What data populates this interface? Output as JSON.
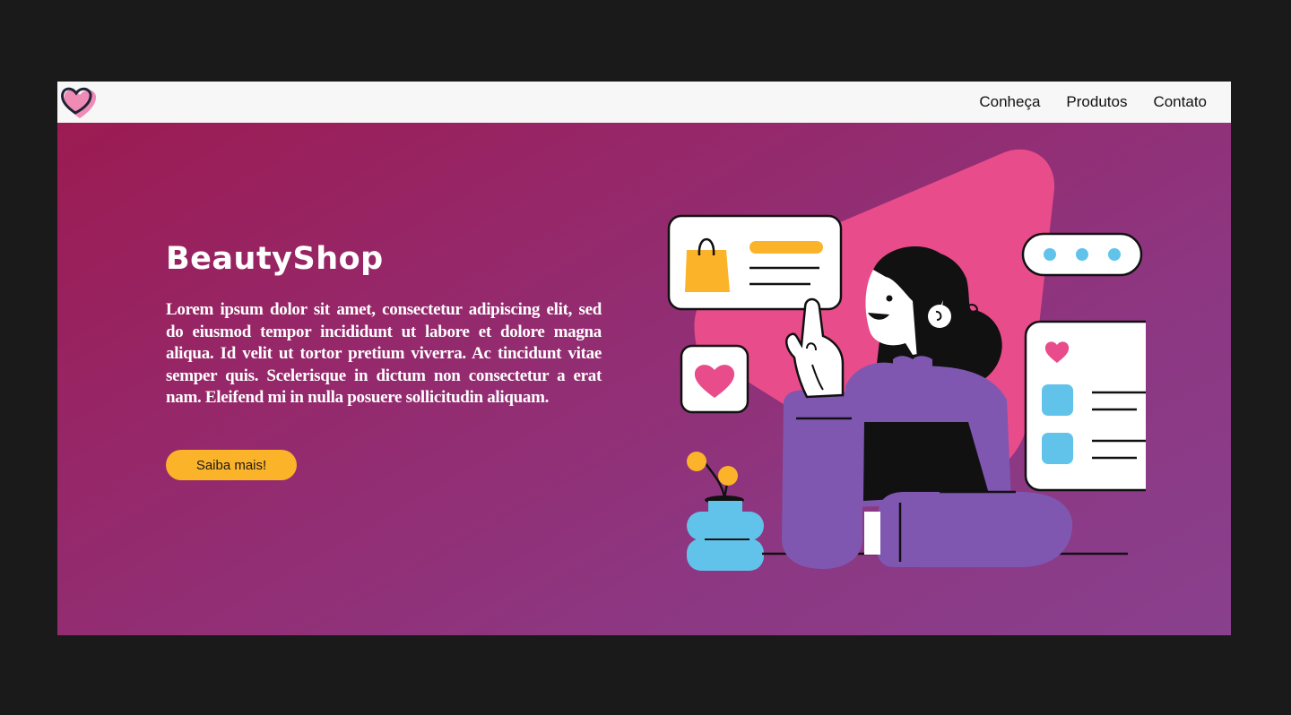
{
  "nav": {
    "links": [
      "Conheça",
      "Produtos",
      "Contato"
    ]
  },
  "hero": {
    "title": "BeautyShop",
    "description": "Lorem ipsum dolor sit amet, consectetur adipiscing elit, sed do eiusmod tempor incididunt ut labore et dolore magna aliqua. Id velit ut tortor pretium viverra. Ac tincidunt vitae semper quis. Scelerisque in dictum non consectetur a erat nam. Eleifend mi in nulla posuere sollicitudin aliquam.",
    "cta_label": "Saiba mais!"
  },
  "icons": {
    "logo": "heart-logo-icon",
    "illustration": "shopping-woman-illustration"
  },
  "colors": {
    "hero_gradient_start": "#9c1b52",
    "hero_gradient_end": "#89408d",
    "accent_yellow": "#fbb32a",
    "accent_pink": "#e84c8b",
    "accent_purple": "#7f57b1",
    "accent_blue": "#62c3ea",
    "navbar_bg": "#f7f7f7"
  }
}
